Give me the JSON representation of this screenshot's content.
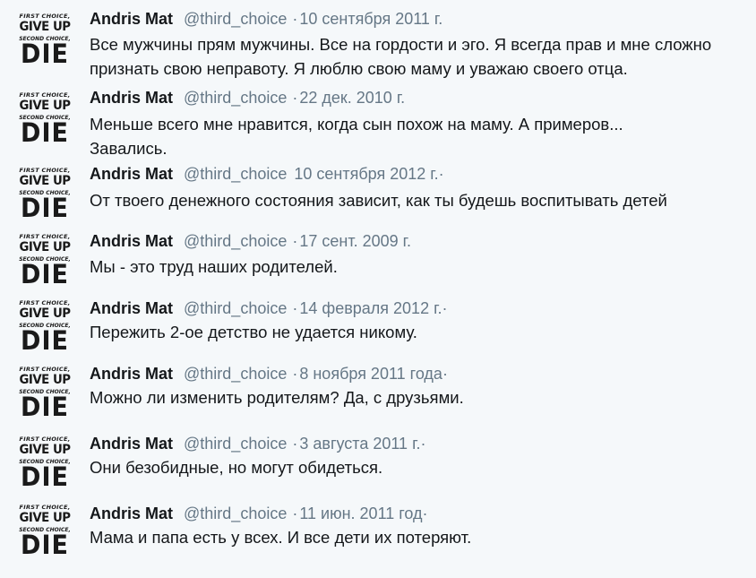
{
  "avatar": {
    "line1": "FIRST CHOICE,",
    "line2": "GIVE UP",
    "line3": "SECOND CHOICE,",
    "line4": "DIE"
  },
  "tweets": [
    {
      "name": "Andris Mat",
      "handle": "@third_choice",
      "dot": "·",
      "date": "10 сентября 2011 г.",
      "text": "Все мужчины прям мужчины. Все на гордости и эго. Я всегда прав и мне сложно признать свою неправоту. Я люблю свою маму и уважаю своего отца."
    },
    {
      "name": "Andris Mat",
      "handle": "@third_choice",
      "dot": "·",
      "date": "22 дек. 2010 г.",
      "text": "Меньше всего мне нравится, когда сын похож на маму. А примеров... Завались."
    },
    {
      "name": "Andris Mat",
      "handle": "@third_choice",
      "dot": "",
      "date": "10 сентября 2012 г.·",
      "text": "От твоего денежного состояния зависит, как ты будешь воспитывать детей"
    },
    {
      "name": "Andris Mat",
      "handle": "@third_choice",
      "dot": "·",
      "date": "17 сент. 2009 г.",
      "text": "Мы - это труд наших родителей."
    },
    {
      "name": "Andris Mat",
      "handle": "@third_choice",
      "dot": "·",
      "date": "14 февраля 2012 г.·",
      "text": "Пережить 2-ое детство не удается никому."
    },
    {
      "name": "Andris Mat",
      "handle": "@third_choice",
      "dot": "·",
      "date": "8 ноября 2011 года·",
      "text": "Можно ли изменить родителям? Да, с друзьями."
    },
    {
      "name": "Andris Mat",
      "handle": "@third_choice",
      "dot": "·",
      "date": "3 августа 2011 г.·",
      "text": "Они безобидные, но могут обидеться."
    },
    {
      "name": "Andris Mat",
      "handle": "@third_choice",
      "dot": "·",
      "date": "11 июн. 2011 год·",
      "text": "Мама и папа есть у всех. И все дети их потеряют."
    }
  ]
}
